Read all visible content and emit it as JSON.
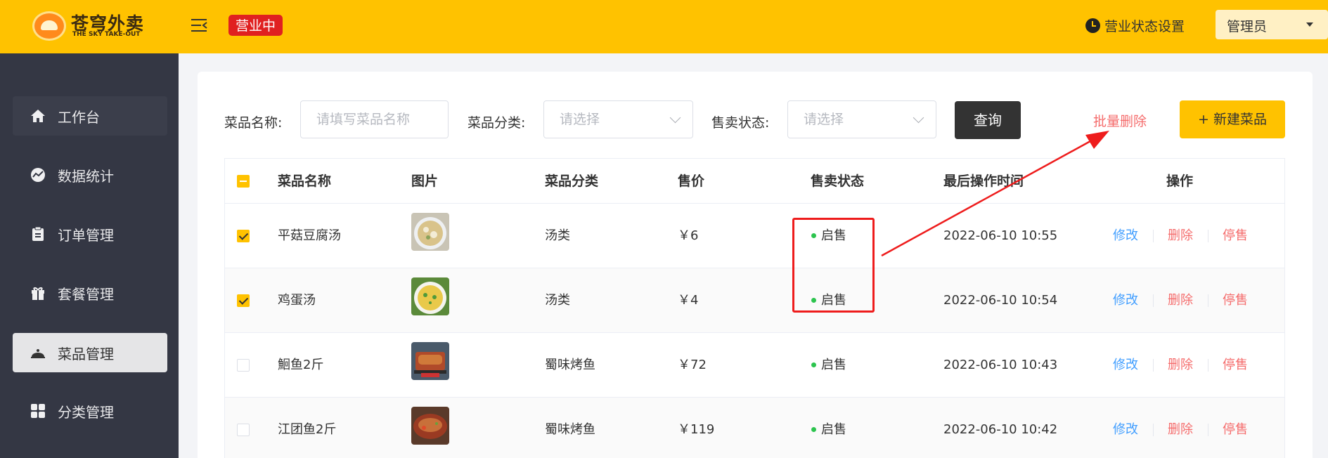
{
  "header": {
    "logo_title": "苍穹外卖",
    "logo_subtitle": "THE SKY TAKE-OUT",
    "business_status": "营业中",
    "status_setting_label": "营业状态设置",
    "user_name": "管理员"
  },
  "sidebar": {
    "items": [
      {
        "label": "工作台",
        "icon": "home-icon"
      },
      {
        "label": "数据统计",
        "icon": "chart-icon"
      },
      {
        "label": "订单管理",
        "icon": "clipboard-icon"
      },
      {
        "label": "套餐管理",
        "icon": "gift-icon"
      },
      {
        "label": "菜品管理",
        "icon": "dish-cover-icon"
      },
      {
        "label": "分类管理",
        "icon": "grid-icon"
      }
    ],
    "active": "菜品管理"
  },
  "filters": {
    "name_label": "菜品名称:",
    "name_placeholder": "请填写菜品名称",
    "category_label": "菜品分类:",
    "category_placeholder": "请选择",
    "status_label": "售卖状态:",
    "status_placeholder": "请选择",
    "query_button": "查询",
    "batch_delete": "批量删除",
    "new_dish": "+ 新建菜品"
  },
  "table": {
    "columns": [
      "菜品名称",
      "图片",
      "菜品分类",
      "售价",
      "售卖状态",
      "最后操作时间",
      "操作"
    ],
    "rows": [
      {
        "checked": true,
        "name": "平菇豆腐汤",
        "category": "汤类",
        "price": "￥6",
        "status": "启售",
        "updated": "2022-06-10 10:55"
      },
      {
        "checked": true,
        "name": "鸡蛋汤",
        "category": "汤类",
        "price": "￥4",
        "status": "启售",
        "updated": "2022-06-10 10:54"
      },
      {
        "checked": false,
        "name": "鮰鱼2斤",
        "category": "蜀味烤鱼",
        "price": "￥72",
        "status": "启售",
        "updated": "2022-06-10 10:43"
      },
      {
        "checked": false,
        "name": "江团鱼2斤",
        "category": "蜀味烤鱼",
        "price": "￥119",
        "status": "启售",
        "updated": "2022-06-10 10:42"
      }
    ],
    "actions": {
      "edit": "修改",
      "delete": "删除",
      "stop": "停售"
    }
  },
  "colors": {
    "brand": "#ffc200",
    "sidebar": "#343744",
    "danger": "#f56c6c",
    "link": "#419eff",
    "status_dot": "#2cc44e",
    "annotation": "#ee1c1c"
  }
}
